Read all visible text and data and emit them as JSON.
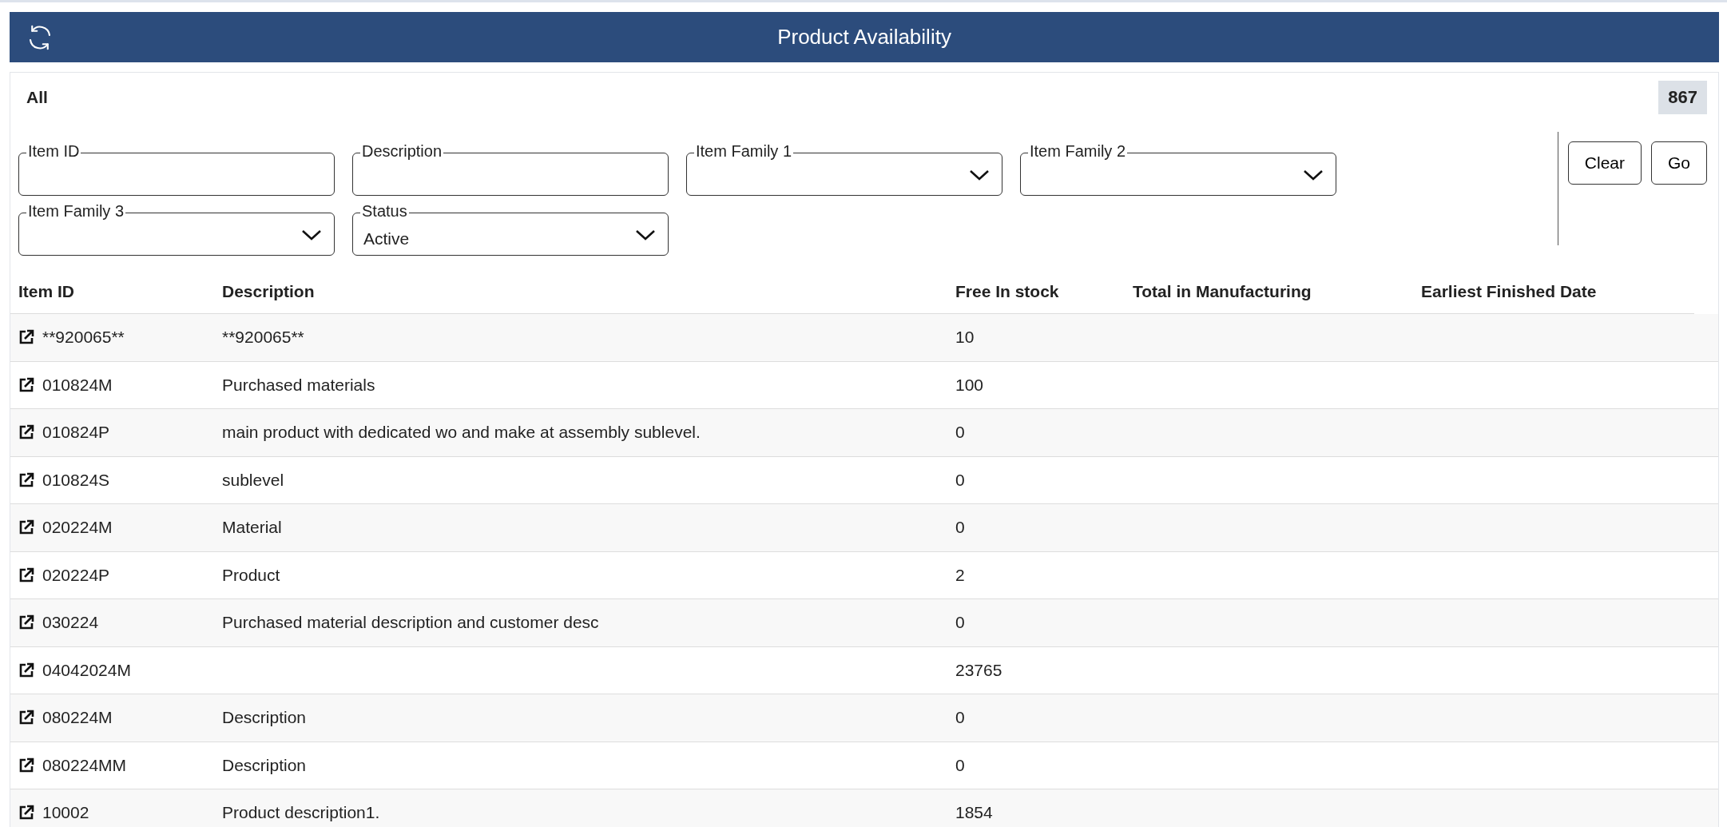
{
  "header": {
    "title": "Product Availability"
  },
  "filter_bar": {
    "view": "All",
    "count": "867"
  },
  "filters": [
    {
      "kind": "text",
      "label": "Item ID"
    },
    {
      "kind": "text",
      "label": "Description"
    },
    {
      "kind": "select",
      "label": "Item Family 1"
    },
    {
      "kind": "select",
      "label": "Item Family 2"
    },
    {
      "kind": "select",
      "label": "Item Family 3"
    },
    {
      "kind": "select",
      "label": "Status",
      "value": "Active"
    }
  ],
  "buttons": [
    "Clear",
    "Go"
  ],
  "table": {
    "columns": [
      "Item ID",
      "Description",
      "Free In stock",
      "Total in Manufacturing",
      "Earliest Finished Date"
    ],
    "rows": [
      {
        "item_id": "**920065**",
        "description": "**920065**",
        "free_in_stock": "10"
      },
      {
        "item_id": "010824M",
        "description": "Purchased materials",
        "free_in_stock": "100"
      },
      {
        "item_id": "010824P",
        "description": "main product with dedicated wo and make at assembly sublevel.",
        "free_in_stock": "0"
      },
      {
        "item_id": "010824S",
        "description": "sublevel",
        "free_in_stock": "0"
      },
      {
        "item_id": "020224M",
        "description": "Material",
        "free_in_stock": "0"
      },
      {
        "item_id": "020224P",
        "description": "Product",
        "free_in_stock": "2"
      },
      {
        "item_id": "030224",
        "description": "Purchased material description and customer desc",
        "free_in_stock": "0"
      },
      {
        "item_id": "04042024M",
        "free_in_stock": "23765"
      },
      {
        "item_id": "080224M",
        "description": "Description",
        "free_in_stock": "0"
      },
      {
        "item_id": "080224MM",
        "description": "Description",
        "free_in_stock": "0"
      },
      {
        "item_id": "10002",
        "description": "Product description1.",
        "free_in_stock": "1854"
      }
    ]
  }
}
